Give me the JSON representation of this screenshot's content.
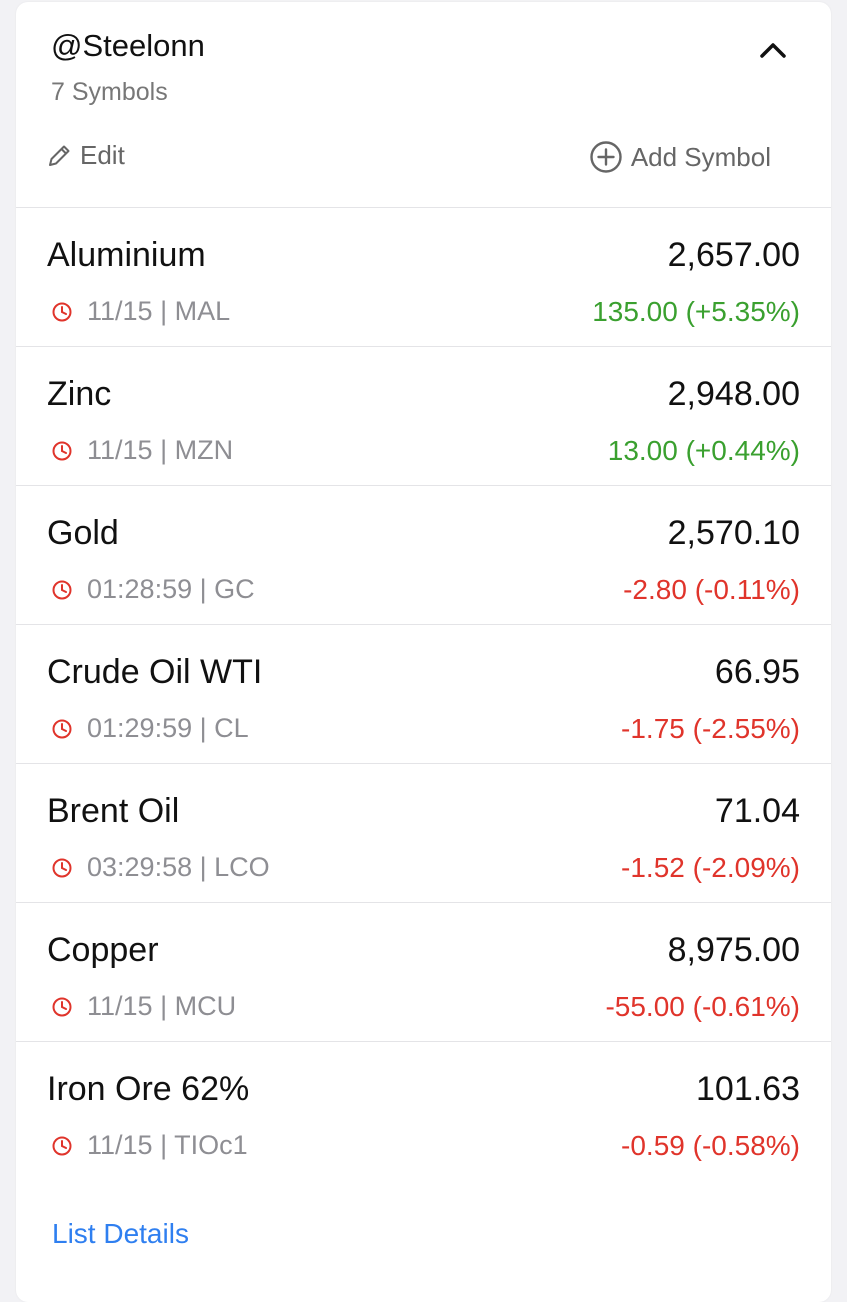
{
  "header": {
    "list_name": "@Steelonn",
    "symbol_count": "7 Symbols",
    "edit_label": "Edit",
    "add_symbol_label": "Add Symbol",
    "collapse_icon": "chevron-up-icon"
  },
  "colors": {
    "positive": "#3aa02f",
    "negative": "#e0342b",
    "link": "#2f7ff0",
    "clock_icon": "#e0342b"
  },
  "symbols": [
    {
      "name": "Aluminium",
      "price": "2,657.00",
      "meta": "11/15 | MAL",
      "change": "135.00 (+5.35%)",
      "direction": "up"
    },
    {
      "name": "Zinc",
      "price": "2,948.00",
      "meta": "11/15 | MZN",
      "change": "13.00 (+0.44%)",
      "direction": "up"
    },
    {
      "name": "Gold",
      "price": "2,570.10",
      "meta": "01:28:59 | GC",
      "change": "-2.80 (-0.11%)",
      "direction": "down"
    },
    {
      "name": "Crude Oil WTI",
      "price": "66.95",
      "meta": "01:29:59 | CL",
      "change": "-1.75 (-2.55%)",
      "direction": "down"
    },
    {
      "name": "Brent Oil",
      "price": "71.04",
      "meta": "03:29:58 | LCO",
      "change": "-1.52 (-2.09%)",
      "direction": "down"
    },
    {
      "name": "Copper",
      "price": "8,975.00",
      "meta": "11/15 | MCU",
      "change": "-55.00 (-0.61%)",
      "direction": "down"
    },
    {
      "name": "Iron Ore 62%",
      "price": "101.63",
      "meta": "11/15 | TIOc1",
      "change": "-0.59 (-0.58%)",
      "direction": "down"
    }
  ],
  "footer": {
    "list_details_label": "List Details"
  }
}
